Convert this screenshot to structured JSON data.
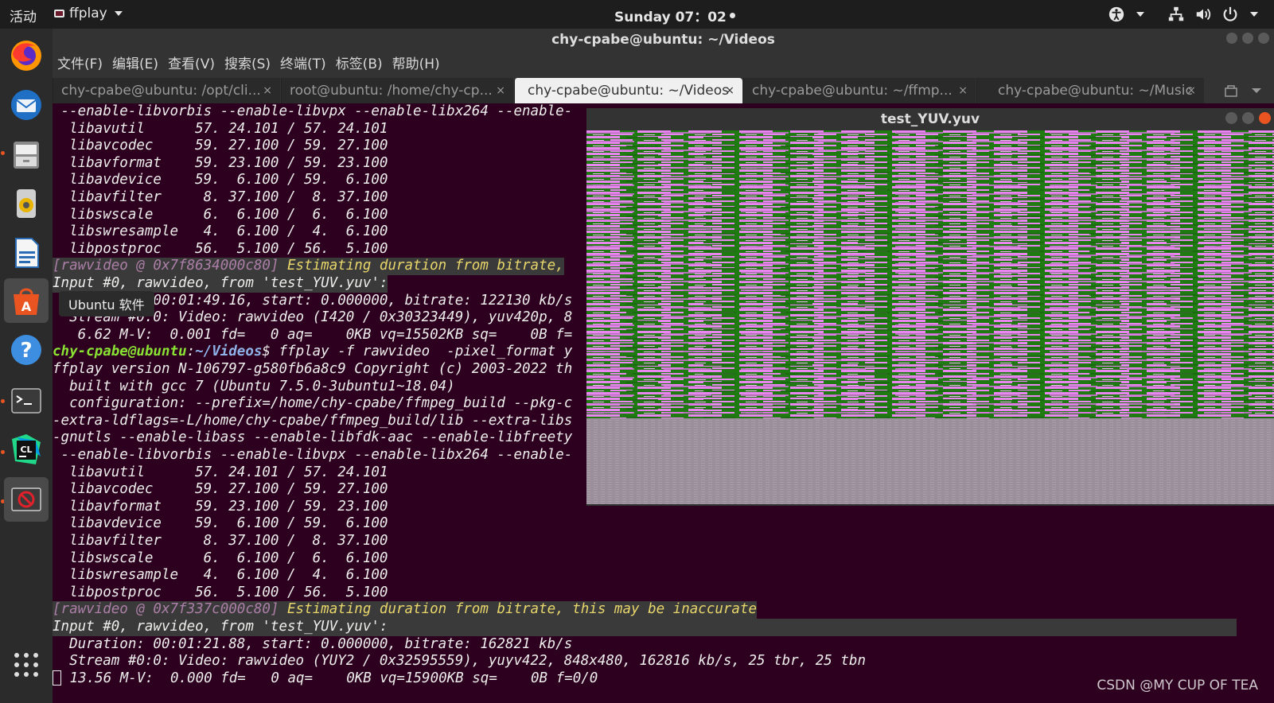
{
  "topbar": {
    "activities": "活动",
    "app_name": "ffplay",
    "clock": "Sunday 07：02"
  },
  "dock": {
    "tooltip": "Ubuntu 软件",
    "items": [
      "firefox-icon",
      "thunderbird-icon",
      "files-icon",
      "rhythmbox-icon",
      "libreoffice-writer-icon",
      "ubuntu-software-icon",
      "help-icon",
      "terminal-icon",
      "clion-icon",
      "ffplay-app-icon",
      "show-apps-icon"
    ]
  },
  "terminal": {
    "title": "chy-cpabe@ubuntu: ~/Videos",
    "menu": [
      "文件(F)",
      "编辑(E)",
      "查看(V)",
      "搜索(S)",
      "终端(T)",
      "标签(B)",
      "帮助(H)"
    ],
    "tabs": [
      {
        "label": "chy-cpabe@ubuntu: /opt/cli...",
        "close": "×"
      },
      {
        "label": "root@ubuntu: /home/chy-cp...",
        "close": "×"
      },
      {
        "label": "chy-cpabe@ubuntu: ~/Videos",
        "close": "×"
      },
      {
        "label": "chy-cpabe@ubuntu: ~/ffmp...",
        "close": "×"
      },
      {
        "label": "chy-cpabe@ubuntu: ~/Music",
        "close": "×"
      }
    ],
    "lines": {
      "l0": " --enable-libvorbis --enable-libvpx --enable-libx264 --enable-",
      "l1": "  libavutil      57. 24.101 / 57. 24.101",
      "l2": "  libavcodec     59. 27.100 / 59. 27.100",
      "l3": "  libavformat    59. 23.100 / 59. 23.100",
      "l4": "  libavdevice    59.  6.100 / 59.  6.100",
      "l5": "  libavfilter     8. 37.100 /  8. 37.100",
      "l6": "  libswscale      6.  6.100 /  6.  6.100",
      "l7": "  libswresample   4.  6.100 /  4.  6.100",
      "l8": "  libpostproc    56.  5.100 / 56.  5.100",
      "l9a": "[rawvideo @ 0x7f8634000c80]",
      "l9b": " Estimating duration from bitrate,",
      "l10": "Input #0, rawvideo, from 'test_YUV.yuv':",
      "l11": "  Duration: 00:01:49.16, start: 0.000000, bitrate: 122130 kb/s",
      "l12": "  Stream #0:0: Video: rawvideo (I420 / 0x30323449), yuv420p, 8",
      "l13": "   6.62 M-V:  0.001 fd=   0 aq=    0KB vq=15502KB sq=    0B f=",
      "l14a": "chy-cpabe@ubuntu",
      "l14b": ":",
      "l14c": "~/Videos",
      "l14d": "$ ffplay -f rawvideo  -pixel_format y",
      "l15": "ffplay version N-106797-g580fb6a8c9 Copyright (c) 2003-2022 th",
      "l16": "  built with gcc 7 (Ubuntu 7.5.0-3ubuntu1~18.04)",
      "l17": "  configuration: --prefix=/home/chy-cpabe/ffmpeg_build --pkg-c",
      "l18": "-extra-ldflags=-L/home/chy-cpabe/ffmpeg_build/lib --extra-libs",
      "l19": "-gnutls --enable-libass --enable-libfdk-aac --enable-libfreety",
      "l20": " --enable-libvorbis --enable-libvpx --enable-libx264 --enable-",
      "l21": "  libavutil      57. 24.101 / 57. 24.101",
      "l22": "  libavcodec     59. 27.100 / 59. 27.100",
      "l23": "  libavformat    59. 23.100 / 59. 23.100",
      "l24": "  libavdevice    59.  6.100 / 59.  6.100",
      "l25": "  libavfilter     8. 37.100 /  8. 37.100",
      "l26": "  libswscale      6.  6.100 /  6.  6.100",
      "l27": "  libswresample   4.  6.100 /  4.  6.100",
      "l28": "  libpostproc    56.  5.100 / 56.  5.100",
      "l29a": "[rawvideo @ 0x7f337c000c80]",
      "l29b": " Estimating duration from bitrate, this may be inaccurate",
      "l30": "Input #0, rawvideo, from 'test_YUV.yuv':",
      "l31": "  Duration: 00:01:21.88, start: 0.000000, bitrate: 162821 kb/s",
      "l32": "  Stream #0:0: Video: rawvideo (YUY2 / 0x32595559), yuyv422, 848x480, 162816 kb/s, 25 tbr, 25 tbn",
      "l33": " 13.56 M-V:  0.000 fd=   0 aq=    0KB vq=15900KB sq=    0B f=0/0"
    }
  },
  "video_window": {
    "title": "test_YUV.yuv"
  },
  "watermark": "CSDN @MY CUP OF TEA",
  "colors": {
    "terminal_bg": "#2c001e",
    "accent": "#e95420",
    "video_magenta": "#e986f0",
    "video_green": "#1f7a12",
    "video_gray": "#9b8f9c"
  }
}
